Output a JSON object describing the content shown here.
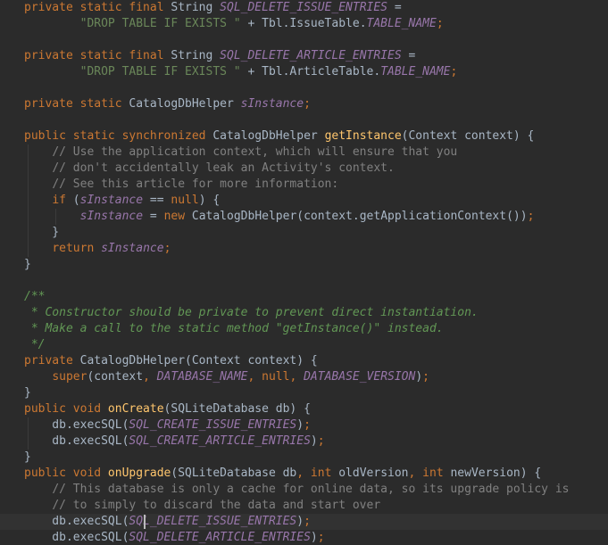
{
  "editor": {
    "language": "Java",
    "colors": {
      "background": "#2b2b2b",
      "text": "#a9b7c6",
      "keyword": "#cc7832",
      "field": "#9876aa",
      "string": "#6a8759",
      "method": "#ffc66d",
      "comment": "#808080",
      "javadoc": "#629755",
      "caret_line": "#323232"
    },
    "caret": {
      "line": 32,
      "column": 17
    },
    "lines": [
      [
        [
          "kw",
          "private static final "
        ],
        [
          "plain",
          "String "
        ],
        [
          "field",
          "SQL_DELETE_ISSUE_ENTRIES"
        ],
        [
          "plain",
          " ="
        ]
      ],
      [
        [
          "plain",
          "        "
        ],
        [
          "str",
          "\"DROP TABLE IF EXISTS \""
        ],
        [
          "plain",
          " + Tbl.IssueTable."
        ],
        [
          "field",
          "TABLE_NAME"
        ],
        [
          "kw",
          ";"
        ]
      ],
      [],
      [
        [
          "kw",
          "private static final "
        ],
        [
          "plain",
          "String "
        ],
        [
          "field",
          "SQL_DELETE_ARTICLE_ENTRIES"
        ],
        [
          "plain",
          " ="
        ]
      ],
      [
        [
          "plain",
          "        "
        ],
        [
          "str",
          "\"DROP TABLE IF EXISTS \""
        ],
        [
          "plain",
          " + Tbl.ArticleTable."
        ],
        [
          "field",
          "TABLE_NAME"
        ],
        [
          "kw",
          ";"
        ]
      ],
      [],
      [
        [
          "kw",
          "private static "
        ],
        [
          "plain",
          "CatalogDbHelper "
        ],
        [
          "field",
          "sInstance"
        ],
        [
          "kw",
          ";"
        ]
      ],
      [],
      [
        [
          "kw",
          "public static synchronized "
        ],
        [
          "plain",
          "CatalogDbHelper "
        ],
        [
          "fn",
          "getInstance"
        ],
        [
          "plain",
          "(Context context) {"
        ]
      ],
      [
        [
          "plain",
          "    "
        ],
        [
          "cmt",
          "// Use the application context, which will ensure that you"
        ]
      ],
      [
        [
          "plain",
          "    "
        ],
        [
          "cmt",
          "// don't accidentally leak an Activity's context."
        ]
      ],
      [
        [
          "plain",
          "    "
        ],
        [
          "cmt",
          "// See this article for more information:"
        ]
      ],
      [
        [
          "plain",
          "    "
        ],
        [
          "kw",
          "if "
        ],
        [
          "plain",
          "("
        ],
        [
          "field",
          "sInstance"
        ],
        [
          "plain",
          " == "
        ],
        [
          "kw",
          "null"
        ],
        [
          "plain",
          ") {"
        ]
      ],
      [
        [
          "plain",
          "        "
        ],
        [
          "field",
          "sInstance"
        ],
        [
          "plain",
          " = "
        ],
        [
          "kw",
          "new "
        ],
        [
          "plain",
          "CatalogDbHelper(context.getApplicationContext())"
        ],
        [
          "kw",
          ";"
        ]
      ],
      [
        [
          "plain",
          "    }"
        ]
      ],
      [
        [
          "plain",
          "    "
        ],
        [
          "kw",
          "return "
        ],
        [
          "field",
          "sInstance"
        ],
        [
          "kw",
          ";"
        ]
      ],
      [
        [
          "plain",
          "}"
        ]
      ],
      [],
      [
        [
          "doc",
          "/**"
        ]
      ],
      [
        [
          "doc",
          " * Constructor should be private to prevent direct instantiation."
        ]
      ],
      [
        [
          "doc",
          " * Make a call to the static method \"getInstance()\" instead."
        ]
      ],
      [
        [
          "doc",
          " */"
        ]
      ],
      [
        [
          "kw",
          "private "
        ],
        [
          "plain",
          "CatalogDbHelper(Context context) {"
        ]
      ],
      [
        [
          "plain",
          "    "
        ],
        [
          "kw",
          "super"
        ],
        [
          "plain",
          "(context"
        ],
        [
          "kw",
          ", "
        ],
        [
          "field",
          "DATABASE_NAME"
        ],
        [
          "kw",
          ", null, "
        ],
        [
          "field",
          "DATABASE_VERSION"
        ],
        [
          "plain",
          ")"
        ],
        [
          "kw",
          ";"
        ]
      ],
      [
        [
          "plain",
          "}"
        ]
      ],
      [
        [
          "kw",
          "public void "
        ],
        [
          "fn",
          "onCreate"
        ],
        [
          "plain",
          "(SQLiteDatabase db) {"
        ]
      ],
      [
        [
          "plain",
          "    db.execSQL("
        ],
        [
          "field",
          "SQL_CREATE_ISSUE_ENTRIES"
        ],
        [
          "plain",
          ")"
        ],
        [
          "kw",
          ";"
        ]
      ],
      [
        [
          "plain",
          "    db.execSQL("
        ],
        [
          "field",
          "SQL_CREATE_ARTICLE_ENTRIES"
        ],
        [
          "plain",
          ")"
        ],
        [
          "kw",
          ";"
        ]
      ],
      [
        [
          "plain",
          "}"
        ]
      ],
      [
        [
          "kw",
          "public void "
        ],
        [
          "fn",
          "onUpgrade"
        ],
        [
          "plain",
          "(SQLiteDatabase db"
        ],
        [
          "kw",
          ", int "
        ],
        [
          "plain",
          "oldVersion"
        ],
        [
          "kw",
          ", int "
        ],
        [
          "plain",
          "newVersion) {"
        ]
      ],
      [
        [
          "plain",
          "    "
        ],
        [
          "cmt",
          "// This database is only a cache for online data, so its upgrade policy is"
        ]
      ],
      [
        [
          "plain",
          "    "
        ],
        [
          "cmt",
          "// to simply to discard the data and start over"
        ]
      ],
      [
        [
          "plain",
          "    db.execSQL("
        ],
        [
          "field",
          "SQL_DELETE_ISSUE_ENTRIES"
        ],
        [
          "plain",
          ")"
        ],
        [
          "kw",
          ";"
        ]
      ],
      [
        [
          "plain",
          "    db.execSQL("
        ],
        [
          "field",
          "SQL_DELETE_ARTICLE_ENTRIES"
        ],
        [
          "plain",
          ")"
        ],
        [
          "kw",
          ";"
        ]
      ]
    ]
  }
}
